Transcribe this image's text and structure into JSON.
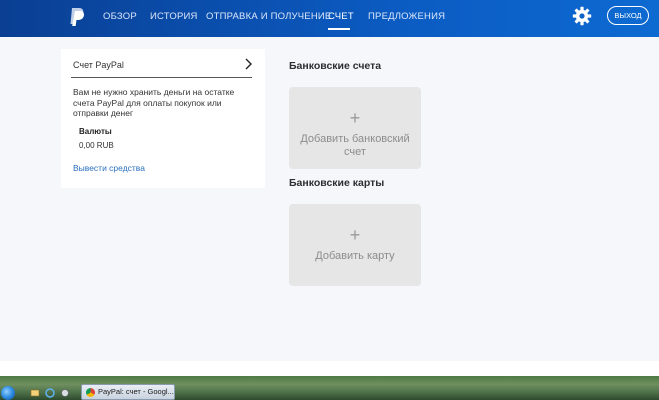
{
  "nav": {
    "items": [
      {
        "label": "ОБЗОР"
      },
      {
        "label": "ИСТОРИЯ"
      },
      {
        "label": "ОТПРАВКА И ПОЛУЧЕНИЕ"
      },
      {
        "label": "СЧЕТ"
      },
      {
        "label": "ПРЕДЛОЖЕНИЯ"
      }
    ],
    "active_item": "СЧЕТ",
    "logout_label": "ВЫХОД"
  },
  "account_card": {
    "title": "Счет PayPal",
    "description": "Вам не нужно хранить деньги на остатке счета PayPal для оплаты покупок или отправки денег",
    "currency_label": "Валюты",
    "currency_value": "0,00 RUB",
    "withdraw_label": "Вывести средства"
  },
  "bank_accounts": {
    "title": "Банковские счета",
    "add_label": "Добавить банковский счет",
    "plus": "+"
  },
  "bank_cards": {
    "title": "Банковские карты",
    "add_label": "Добавить карту",
    "plus": "+"
  },
  "taskbar": {
    "task_title": "PayPal: счет - Googl..."
  },
  "colors": {
    "nav_blue_dark": "#0a3f93",
    "nav_blue_light": "#0d6ad1",
    "link_blue": "#2a6fbf",
    "tile_gray": "#e6e6e6"
  },
  "icons": {
    "logo": "paypal-logo",
    "settings": "gear-icon",
    "chevron": "chevron-right-icon"
  }
}
